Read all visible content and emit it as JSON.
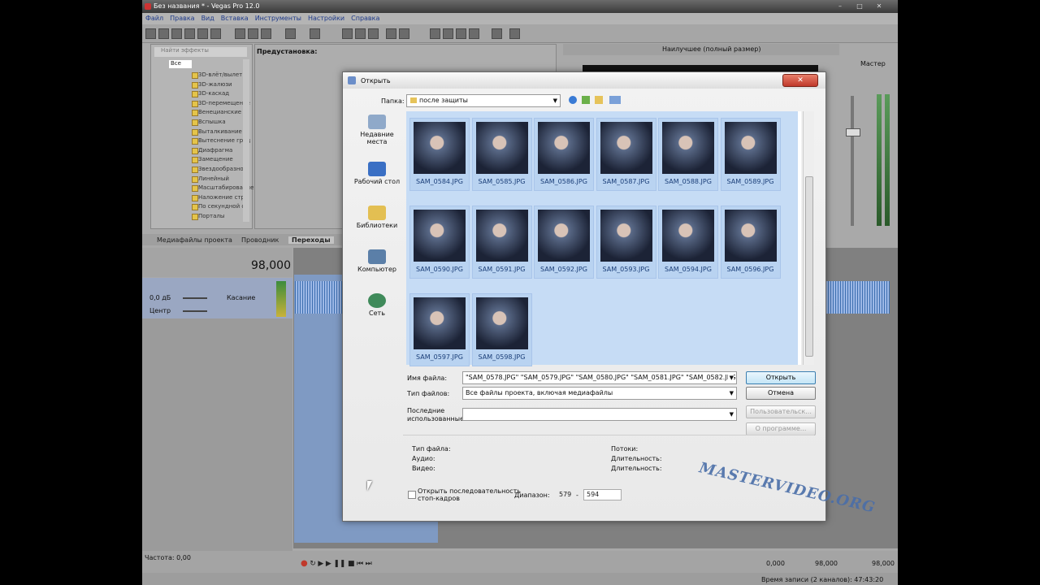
{
  "app": {
    "title": "Без названия * - Vegas Pro 12.0",
    "menu": [
      "Файл",
      "Правка",
      "Вид",
      "Вставка",
      "Инструменты",
      "Настройки",
      "Справка"
    ],
    "preset_label": "Предустановка:",
    "search_placeholder": "Найти эффекты",
    "tree_root": "Все",
    "tree_items": [
      "3D-влёт/вылет",
      "3D-жалюзи",
      "3D-каскад",
      "3D-перемещение",
      "Венецианские ж",
      "Вспышка",
      "Выталкивание",
      "Вытеснение град",
      "Диафрагма",
      "Замещение",
      "Звездообразное",
      "Линейный",
      "Масштабирование",
      "Наложение стра",
      "По секундной ст",
      "Порталы"
    ],
    "tabs": [
      "Медиафайлы проекта",
      "Проводник",
      "Переходы"
    ],
    "preview_quality": "Наилучшее (полный размер)",
    "master_label": "Мастер",
    "time_display": "98,000",
    "track": {
      "volume": "0,0 дБ",
      "pan": "Центр",
      "mode": "Касание"
    },
    "rate_label": "Частота: 0,00",
    "time_a": "0,000",
    "time_b": "98,000",
    "time_c": "98,000",
    "status_text": "Время записи (2 каналов): 47:43:20"
  },
  "dialog": {
    "title": "Открыть",
    "folder_label": "Папка:",
    "folder_value": "после защиты",
    "places": [
      "Недавние места",
      "Рабочий стол",
      "Библиотеки",
      "Компьютер",
      "Сеть"
    ],
    "files": [
      "SAM_0584.JPG",
      "SAM_0585.JPG",
      "SAM_0586.JPG",
      "SAM_0587.JPG",
      "SAM_0588.JPG",
      "SAM_0589.JPG",
      "SAM_0590.JPG",
      "SAM_0591.JPG",
      "SAM_0592.JPG",
      "SAM_0593.JPG",
      "SAM_0594.JPG",
      "SAM_0596.JPG",
      "SAM_0597.JPG",
      "SAM_0598.JPG"
    ],
    "filename_label": "Имя файла:",
    "filename_value": "\"SAM_0578.JPG\" \"SAM_0579.JPG\" \"SAM_0580.JPG\" \"SAM_0581.JPG\" \"SAM_0582.JPG\"",
    "filetype_label": "Тип файлов:",
    "filetype_value": "Все файлы проекта, включая медиафайлы",
    "recent_label_1": "Последние",
    "recent_label_2": "использованные:",
    "open_button": "Открыть",
    "cancel_button": "Отмена",
    "custom_button": "Пользовательск...",
    "about_button": "О программе...",
    "info_type": "Тип файла:",
    "info_audio": "Аудио:",
    "info_video": "Видео:",
    "info_streams": "Потоки:",
    "info_duration_1": "Длительность:",
    "info_duration_2": "Длительность:",
    "sequence_label_1": "Открыть последовательность",
    "sequence_label_2": "стоп-кадров",
    "range_label": "Диапазон:",
    "range_from": "579",
    "range_dash": "-",
    "range_to": "594"
  },
  "watermark": "MASTERVIDEO.ORG",
  "colors": {
    "selection": "#c6dcf5",
    "accent": "#3c7fb1"
  }
}
